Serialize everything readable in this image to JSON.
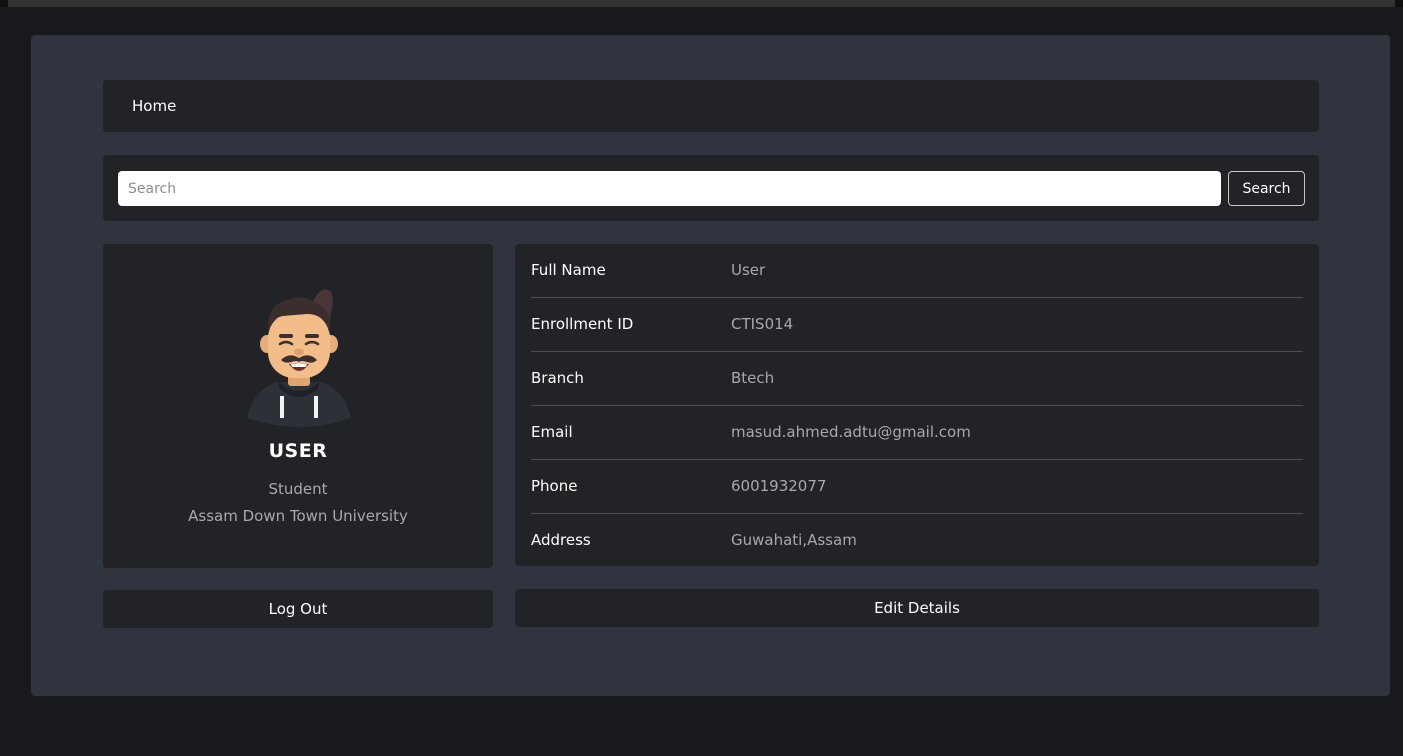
{
  "nav": {
    "home_label": "Home"
  },
  "search": {
    "placeholder": "Search",
    "value": "",
    "button_label": "Search"
  },
  "profile": {
    "name": "USER",
    "role": "Student",
    "university": "Assam Down Town University"
  },
  "details": {
    "rows": [
      {
        "label": "Full Name",
        "value": "User"
      },
      {
        "label": "Enrollment ID",
        "value": "CTIS014"
      },
      {
        "label": "Branch",
        "value": "Btech"
      },
      {
        "label": "Email",
        "value": "masud.ahmed.adtu@gmail.com"
      },
      {
        "label": "Phone",
        "value": "6001932077"
      },
      {
        "label": "Address",
        "value": "Guwahati,Assam"
      }
    ]
  },
  "actions": {
    "logout_label": "Log Out",
    "edit_label": "Edit Details"
  },
  "colors": {
    "page_bg": "#18191c",
    "panel_bg": "#30343f",
    "card_bg": "#212327",
    "text_primary": "#ffffff",
    "text_muted": "#a6a9ad"
  },
  "icons": {
    "avatar": "bearded-man-avatar-icon"
  }
}
